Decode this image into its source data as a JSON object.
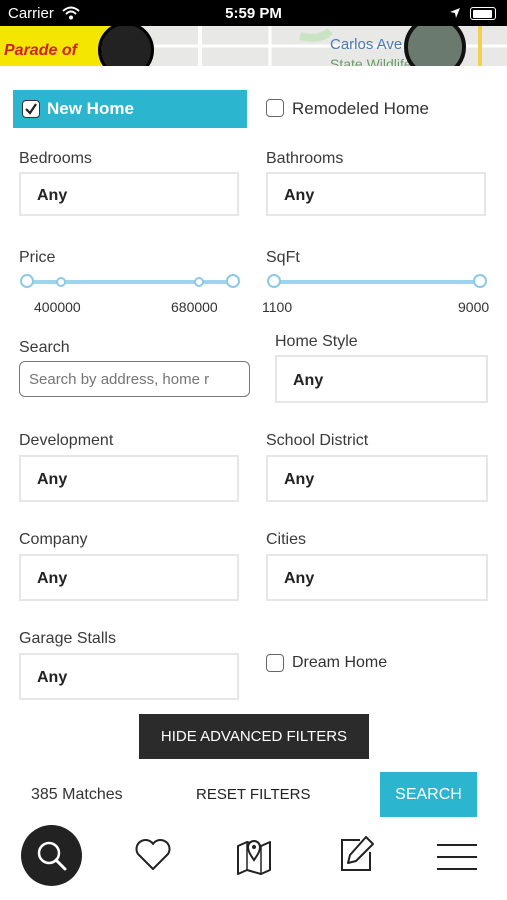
{
  "status_bar": {
    "carrier": "Carrier",
    "time": "5:59 PM"
  },
  "map": {
    "place_label": "Carlos Ave",
    "place_label_2": "State Wildlife",
    "banner_text": "Parade of"
  },
  "filters": {
    "new_home": {
      "label": "New Home",
      "checked": true
    },
    "remodeled_home": {
      "label": "Remodeled Home",
      "checked": false
    },
    "bedrooms": {
      "label": "Bedrooms",
      "value": "Any"
    },
    "bathrooms": {
      "label": "Bathrooms",
      "value": "Any"
    },
    "price": {
      "label": "Price",
      "min_value": "400000",
      "max_value": "680000"
    },
    "sqft": {
      "label": "SqFt",
      "min_value": "1100",
      "max_value": "9000"
    },
    "search": {
      "label": "Search",
      "placeholder": "Search by address, home r"
    },
    "home_style": {
      "label": "Home Style",
      "value": "Any"
    },
    "development": {
      "label": "Development",
      "value": "Any"
    },
    "school_district": {
      "label": "School District",
      "value": "Any"
    },
    "company": {
      "label": "Company",
      "value": "Any"
    },
    "cities": {
      "label": "Cities",
      "value": "Any"
    },
    "garage_stalls": {
      "label": "Garage Stalls",
      "value": "Any"
    },
    "dream_home": {
      "label": "Dream Home",
      "checked": false
    }
  },
  "actions": {
    "hide_advanced": "HIDE ADVANCED FILTERS",
    "matches": "385 Matches",
    "reset": "RESET FILTERS",
    "search": "SEARCH"
  },
  "colors": {
    "accent": "#2bb5cf",
    "slider": "#9fd4ef",
    "dark_button": "#2b2b2b"
  },
  "tab_bar": {
    "items": [
      "search-icon",
      "heart-icon",
      "map-pin-icon",
      "edit-icon",
      "menu-icon"
    ]
  }
}
